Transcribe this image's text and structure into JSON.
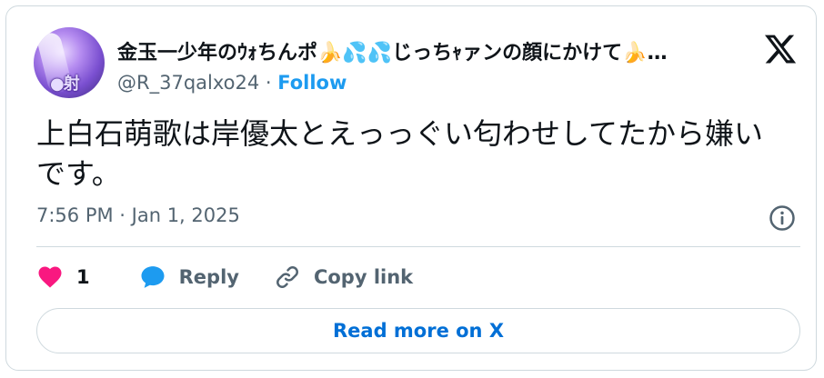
{
  "author": {
    "display_name": "金玉一少年のｳｫちんポ🍌💦💦じっちｬァンの顔にかけて🍌…",
    "handle": "@R_37qalxo24",
    "separator": " · ",
    "follow_label": "Follow",
    "avatar_overlay_text": "●射"
  },
  "tweet": {
    "text": "上白石萌歌は岸優太とえっっぐい匂わせしてたから嫌いです。",
    "timestamp": "7:56 PM · Jan 1, 2025"
  },
  "actions": {
    "like_count": "1",
    "reply_label": "Reply",
    "copy_link_label": "Copy link"
  },
  "read_more_label": "Read more on X",
  "icons": {
    "brand": "x-logo-icon",
    "info": "info-icon",
    "like": "heart-icon",
    "reply": "speech-bubble-icon",
    "copy_link": "link-icon"
  },
  "colors": {
    "accent": "#1d9bf0",
    "read_more": "#006fd6",
    "like": "#f91880",
    "secondary_text": "#536471",
    "border": "#cfd9de"
  }
}
